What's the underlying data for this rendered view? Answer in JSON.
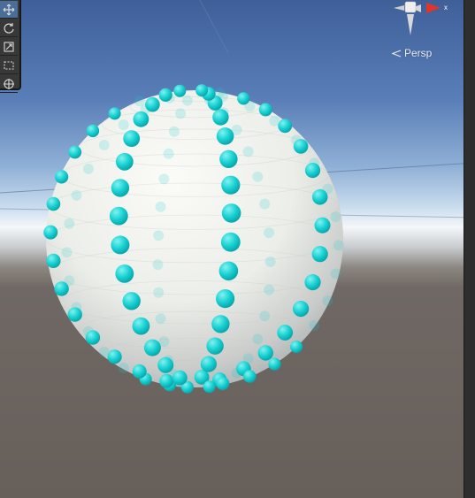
{
  "scene": {
    "sphere_color": "#e8e9e6",
    "dot_color": "#14cdd0",
    "sky_color": "#5a7fb8",
    "ground_color": "#6a625d"
  },
  "toolbar": {
    "tools": [
      {
        "name": "move-tool",
        "icon": "move-arrows-icon",
        "active": true
      },
      {
        "name": "rotate-tool",
        "icon": "rotate-icon",
        "active": false
      },
      {
        "name": "scale-tool",
        "icon": "scale-icon",
        "active": false
      },
      {
        "name": "rect-tool",
        "icon": "rect-icon",
        "active": false
      },
      {
        "name": "transform-tool",
        "icon": "transform-icon",
        "active": false
      }
    ]
  },
  "orientation_gizmo": {
    "axis_label": "x",
    "projection_label": "Persp",
    "axis_color": "#e0352b"
  }
}
